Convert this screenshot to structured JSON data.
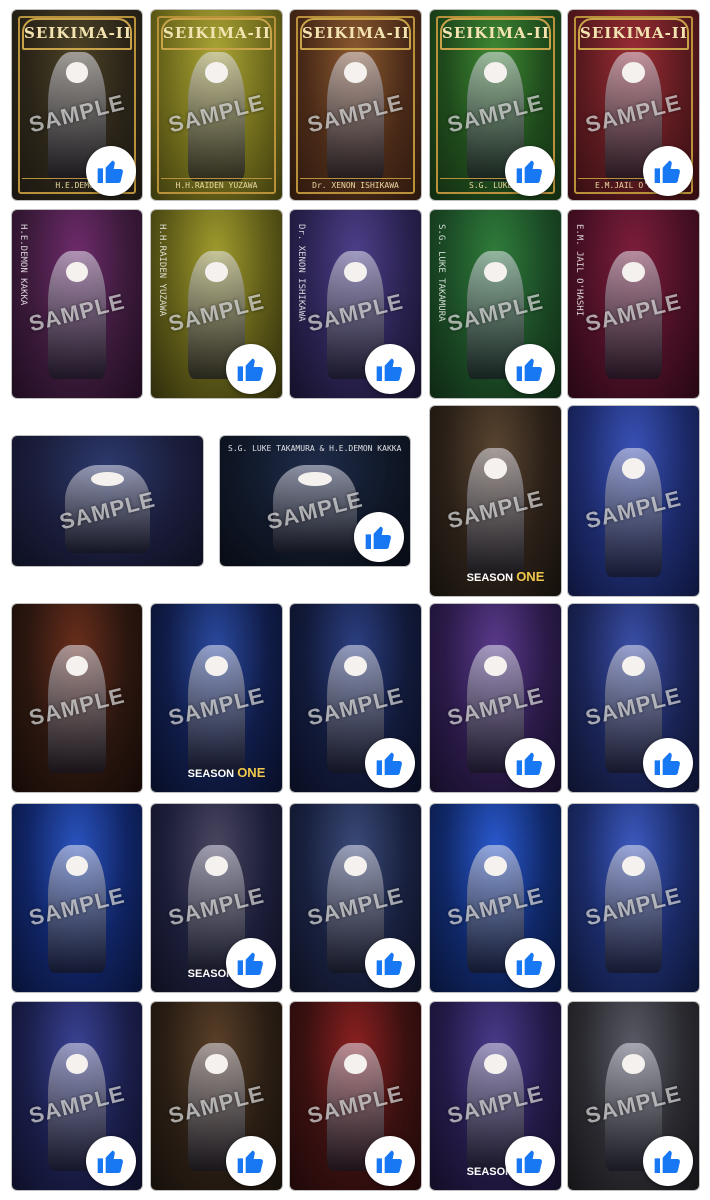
{
  "watermark": "SAMPLE",
  "like_icon": "thumbs-up-icon",
  "colors": {
    "like_blue": "#1877f2",
    "gold": "#b8913a"
  },
  "rows": [
    [
      {
        "bg": [
          "#2a2418",
          "#4c4226",
          "#1a1610"
        ],
        "title": "SEIKIMA-II",
        "caption": "H.E.DEMON",
        "like": true
      },
      {
        "bg": [
          "#6e6a1c",
          "#aba535",
          "#3a380d"
        ],
        "title": "SEIKIMA-II",
        "caption": "H.H.RAIDEN YUZAWA",
        "like": false
      },
      {
        "bg": [
          "#4a2a18",
          "#8c5a30",
          "#2b170c"
        ],
        "title": "SEIKIMA-II",
        "caption": "Dr. XENON ISHIKAWA",
        "like": false
      },
      {
        "bg": [
          "#1f4a1c",
          "#3f8a34",
          "#122b10"
        ],
        "title": "SEIKIMA-II",
        "caption": "S.G. LUKE T",
        "like": true
      },
      {
        "bg": [
          "#5a1a1f",
          "#9b2d34",
          "#300c10"
        ],
        "title": "SEIKIMA-II",
        "caption": "E.M.JAIL O'HASHI",
        "like": true
      }
    ],
    [
      {
        "bg": [
          "#3b1a3a",
          "#6e2b6c",
          "#1f0c20"
        ],
        "vlabel": "H.E.DEMON KAKKA",
        "like": false
      },
      {
        "bg": [
          "#5d5a18",
          "#a19c2d",
          "#2e2c0b"
        ],
        "vlabel": "H.H.RAIDEN YUZAWA",
        "like": true
      },
      {
        "bg": [
          "#2a2250",
          "#4e3f8a",
          "#151029"
        ],
        "vlabel": "Dr. XENON ISHIKAWA",
        "like": true
      },
      {
        "bg": [
          "#1b4a25",
          "#2f7d3b",
          "#0e2713"
        ],
        "vlabel": "S.G. LUKE TAKAMURA",
        "like": true
      },
      {
        "bg": [
          "#4a1025",
          "#7d1e3b",
          "#260713"
        ],
        "vlabel": "E.M. JAIL O'HASHI",
        "like": false
      }
    ],
    [
      {
        "bg": [
          "#1a1d3a",
          "#2d3a6e",
          "#0d0f20"
        ],
        "like": false
      },
      {
        "bg": [
          "#101828",
          "#1f2c4a",
          "#070b14"
        ],
        "hlabel": "S.G. LUKE TAKAMURA & H.E.DEMON KAKKA",
        "like": true
      },
      {
        "bg": [
          "#2a2018",
          "#5a4530",
          "#15100b"
        ],
        "logo_a": "SEASON ",
        "logo_b": "ONE",
        "like": false
      },
      {
        "bg": [
          "#1c2a6a",
          "#3a52b8",
          "#0e153a"
        ],
        "like": false
      }
    ],
    [
      {
        "bg": [
          "#2a160f",
          "#6a2e1c",
          "#150a06"
        ],
        "like": false
      },
      {
        "bg": [
          "#101c48",
          "#2a4aa0",
          "#080e26"
        ],
        "logo_a": "SEASON ",
        "logo_b": "ONE",
        "like": false
      },
      {
        "bg": [
          "#121a3a",
          "#2b3f82",
          "#090d20"
        ],
        "like": true
      },
      {
        "bg": [
          "#2a1a48",
          "#5a3a8c",
          "#150d26"
        ],
        "like": true
      },
      {
        "bg": [
          "#1a2456",
          "#3a4fa8",
          "#0d122c"
        ],
        "like": true
      }
    ],
    [
      {
        "bg": [
          "#102464",
          "#2a54c0",
          "#081234"
        ],
        "like": false
      },
      {
        "bg": [
          "#1c1e3a",
          "#4a4660",
          "#0e0f1e"
        ],
        "logo_a": "SEASON ",
        "logo_b": "ONE",
        "like": true
      },
      {
        "bg": [
          "#18203e",
          "#3a4a78",
          "#0c1020"
        ],
        "like": true
      },
      {
        "bg": [
          "#102868",
          "#2a5ad0",
          "#081436"
        ],
        "like": true
      },
      {
        "bg": [
          "#1a2a66",
          "#3c5ac0",
          "#0d1534"
        ],
        "like": false
      }
    ],
    [
      {
        "bg": [
          "#1a1e4a",
          "#3a4294",
          "#0d0f26"
        ],
        "like": true
      },
      {
        "bg": [
          "#2a1e14",
          "#5a4028",
          "#150f0a"
        ],
        "like": true
      },
      {
        "bg": [
          "#3a1010",
          "#8c2020",
          "#1e0808"
        ],
        "like": true
      },
      {
        "bg": [
          "#241a48",
          "#4a3a8a",
          "#120d24"
        ],
        "logo_a": "SEASON ",
        "logo_b": "ONE",
        "like": true
      },
      {
        "bg": [
          "#2a2a30",
          "#5a5a66",
          "#151518"
        ],
        "like": true
      }
    ]
  ]
}
